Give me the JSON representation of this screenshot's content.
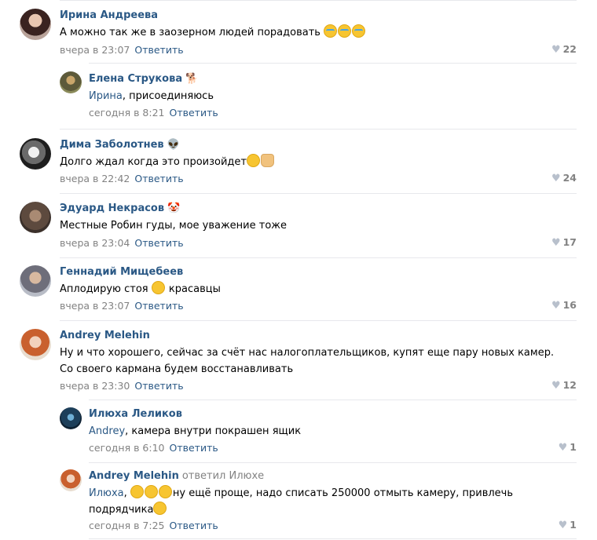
{
  "comments": [
    {
      "author": "Ирина Андреева",
      "author_emoji": "",
      "text": "А можно так же в заозерном людей порадовать",
      "text_emojis": [
        "tears-of-joy",
        "tears-of-joy",
        "tears-of-joy"
      ],
      "time": "вчера в 23:07",
      "reply_label": "Ответить",
      "likes": "22",
      "replies": [
        {
          "author": "Елена Струкова",
          "author_emoji": "🐕",
          "mention": "Ирина",
          "text": ", присоединяюсь",
          "time": "сегодня в 8:21",
          "reply_label": "Ответить"
        }
      ]
    },
    {
      "author": "Дима Заболотнев",
      "author_emoji": "👽",
      "text": "Долго ждал когда это произойдет",
      "text_emojis": [
        "grinning",
        "thumbs-up"
      ],
      "time": "вчера в 22:42",
      "reply_label": "Ответить",
      "likes": "24"
    },
    {
      "author": "Эдуард Некрасов",
      "author_emoji": "🤡",
      "text": "Местные Робин гуды, мое уважение тоже",
      "time": "вчера в 23:04",
      "reply_label": "Ответить",
      "likes": "17"
    },
    {
      "author": "Геннадий Мищебеев",
      "text_before": "Аплодирую стоя",
      "text_after": "красавцы",
      "text_emojis": [
        "beaming"
      ],
      "time": "вчера в 23:07",
      "reply_label": "Ответить",
      "likes": "16"
    },
    {
      "author": "Andrey Melehin",
      "text_line1": "Ну и что хорошего, сейчас за счёт нас налогоплательщиков, купят еще пару новых камер.",
      "text_line2": "Со своего кармана будем восстанавливать",
      "time": "вчера в 23:30",
      "reply_label": "Ответить",
      "likes": "12",
      "replies": [
        {
          "author": "Илюха Леликов",
          "mention": "Andrey",
          "text": ", камера внутри покрашен ящик",
          "time": "сегодня в 6:10",
          "reply_label": "Ответить",
          "likes": "1"
        },
        {
          "author": "Andrey Melehin",
          "replied_to": "ответил Илюхе",
          "mention": "Илюха",
          "text_line1": "ну ещё проще, надо списать 250000 отмыть камеру, привлечь",
          "text_line2": "подрядчика",
          "text_emojis": [
            "rofl",
            "rofl",
            "rofl",
            "rofl"
          ],
          "time": "сегодня в 7:25",
          "reply_label": "Ответить",
          "likes": "1"
        }
      ]
    }
  ],
  "colors": {
    "link": "#2a5885",
    "meta": "#828282",
    "separator": "#e7e8ec",
    "heart": "#b8c0cc"
  }
}
